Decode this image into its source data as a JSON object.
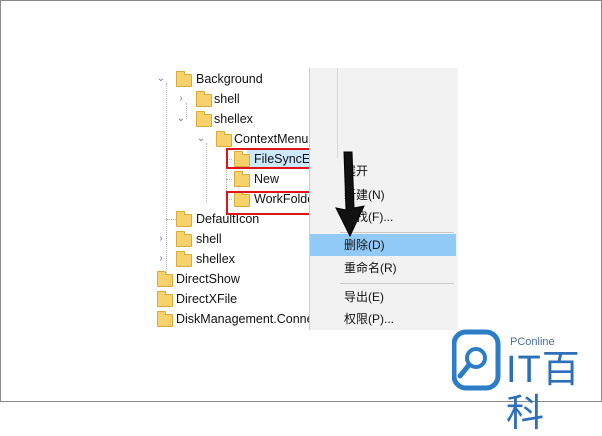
{
  "tree": {
    "items": [
      {
        "label": "Background",
        "expander": "expanded"
      },
      {
        "label": "shell",
        "expander": "collapsed"
      },
      {
        "label": "shellex",
        "expander": "expanded"
      },
      {
        "label": "ContextMenuHandlers",
        "expander": "expanded"
      },
      {
        "label": "FileSyncEx",
        "expander": "none",
        "highlight": "red-box",
        "selected": true
      },
      {
        "label": "New",
        "expander": "none"
      },
      {
        "label": "WorkFolders",
        "expander": "none",
        "highlight": "red-box"
      },
      {
        "label": "DefaultIcon",
        "expander": "none"
      },
      {
        "label": "shell",
        "expander": "collapsed"
      },
      {
        "label": "shellex",
        "expander": "collapsed"
      },
      {
        "label": "DirectShow",
        "expander": "none"
      },
      {
        "label": "DirectXFile",
        "expander": "none"
      },
      {
        "label": "DiskManagement.Connection",
        "expander": "none"
      }
    ]
  },
  "context_menu": {
    "items": [
      {
        "label": "展开",
        "highlighted": false
      },
      {
        "label": "新建(N)",
        "highlighted": false
      },
      {
        "label": "查找(F)...",
        "highlighted": false
      },
      {
        "label": "删除(D)",
        "highlighted": true
      },
      {
        "label": "重命名(R)",
        "highlighted": false
      },
      {
        "label": "导出(E)",
        "highlighted": false
      },
      {
        "label": "权限(P)...",
        "highlighted": false
      }
    ]
  },
  "watermark": {
    "brand": "PConline",
    "name": "IT百科"
  },
  "colors": {
    "highlight_box": "#e0141c",
    "menu_hover": "#91c9f7",
    "folder": "#f7d16a"
  }
}
